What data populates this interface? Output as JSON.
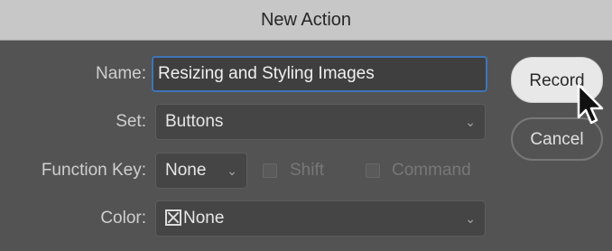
{
  "dialog": {
    "title": "New Action"
  },
  "form": {
    "name_label": "Name:",
    "name_value": "Resizing and Styling Images",
    "set_label": "Set:",
    "set_value": "Buttons",
    "function_key_label": "Function Key:",
    "function_key_value": "None",
    "shift_label": "Shift",
    "shift_checked": false,
    "command_label": "Command",
    "command_checked": false,
    "color_label": "Color:",
    "color_value": "None",
    "color_icon": "x-box-icon"
  },
  "buttons": {
    "record_label": "Record",
    "cancel_label": "Cancel"
  },
  "icons": {
    "dropdown": "chevron-down-icon",
    "cursor": "mouse-pointer-icon"
  },
  "colors": {
    "titlebar": "#c7c7c7",
    "background": "#535353",
    "focus_ring": "#3f74b8"
  }
}
